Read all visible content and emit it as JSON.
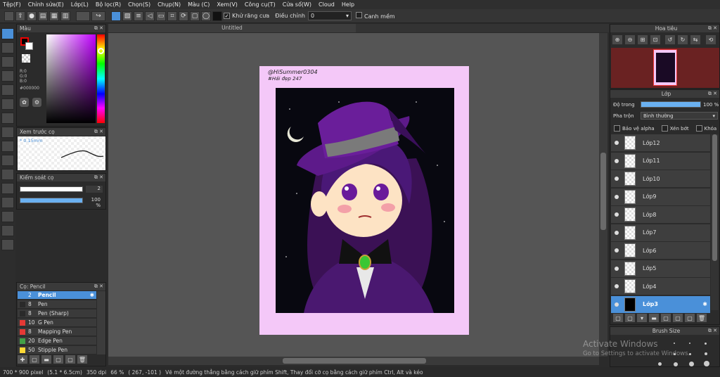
{
  "menu": [
    "Tệp(F)",
    "Chỉnh sửa(E)",
    "Lớp(L)",
    "Bộ lọc(R)",
    "Chọn(S)",
    "Chụp(N)",
    "Màu (C)",
    "Xem(V)",
    "Công cụ(T)",
    "Cửa sổ(W)",
    "Cloud",
    "Help"
  ],
  "toolbar": {
    "antialias_label": "Khử răng cưa",
    "adjust_label": "Điều chỉnh",
    "adjust_value": "0",
    "snap_label": "Canh mềm"
  },
  "panels": {
    "color": {
      "title": "Màu",
      "r": "R:0",
      "g": "G:0",
      "b": "B:0",
      "hex": "#000000"
    },
    "preview": {
      "title": "Xem trước cọ",
      "size": "* 0.15mm"
    },
    "brush_control": {
      "title": "Kiểm soát cọ",
      "size_value": "2",
      "opacity_value": "100 %",
      "opacity_fraction": 1.0
    },
    "brush_list": {
      "title": "Cọ: Pencil",
      "items": [
        {
          "num": "2",
          "name": "Pencil",
          "color": "#4a90d9",
          "selected": true
        },
        {
          "num": "8",
          "name": "Pen",
          "color": "#2a2a2a",
          "selected": false
        },
        {
          "num": "8",
          "name": "Pen (Sharp)",
          "color": "#2a2a2a",
          "selected": false
        },
        {
          "num": "10",
          "name": "G Pen",
          "color": "#e53935",
          "selected": false
        },
        {
          "num": "8",
          "name": "Mapping Pen",
          "color": "#e53935",
          "selected": false
        },
        {
          "num": "20",
          "name": "Edge Pen",
          "color": "#43a047",
          "selected": false
        },
        {
          "num": "50",
          "name": "Stipple Pen",
          "color": "#fdd835",
          "selected": false
        }
      ]
    },
    "navigator": {
      "title": "Hoa tiêu"
    },
    "layer": {
      "title": "Lớp",
      "opacity_label": "Độ trong",
      "opacity_value": "100 %",
      "opacity_fraction": 1.0,
      "blend_label": "Pha trộn",
      "blend_value": "Bình thường",
      "protect_alpha": "Bảo vệ alpha",
      "clipping": "Xén bớt",
      "lock": "Khóa",
      "layers": [
        "Lớp12",
        "Lớp11",
        "Lớp10",
        "Lớp9",
        "Lớp8",
        "Lớp7",
        "Lớp6",
        "Lớp5",
        "Lớp4",
        "Lớp3"
      ],
      "selected": "Lớp3"
    },
    "brush_size": {
      "title": "Brush Size"
    }
  },
  "canvas": {
    "tab_title": "Untitled",
    "signature_line1": "@HiSummer0304",
    "signature_line2": "#Hải đẹp 247"
  },
  "status": {
    "size": "700 * 900 pixel",
    "physical": "(5.1 * 6.5cm)",
    "dpi": "350 dpi",
    "zoom": "66 %",
    "coords": "( 267, -101 )",
    "hint": "Vẽ một đường thẳng bằng cách giữ phím Shift, Thay đổi cỡ cọ bằng cách giữ phím Ctrl, Alt và kéo"
  },
  "watermark": {
    "title": "Activate Windows",
    "subtitle": "Go to Settings to activate Windows."
  },
  "colors": {
    "accent": "#4a90d9",
    "panel": "#2b2b2b",
    "canvas_bg": "#555555",
    "paper": "#f4c8f8"
  }
}
